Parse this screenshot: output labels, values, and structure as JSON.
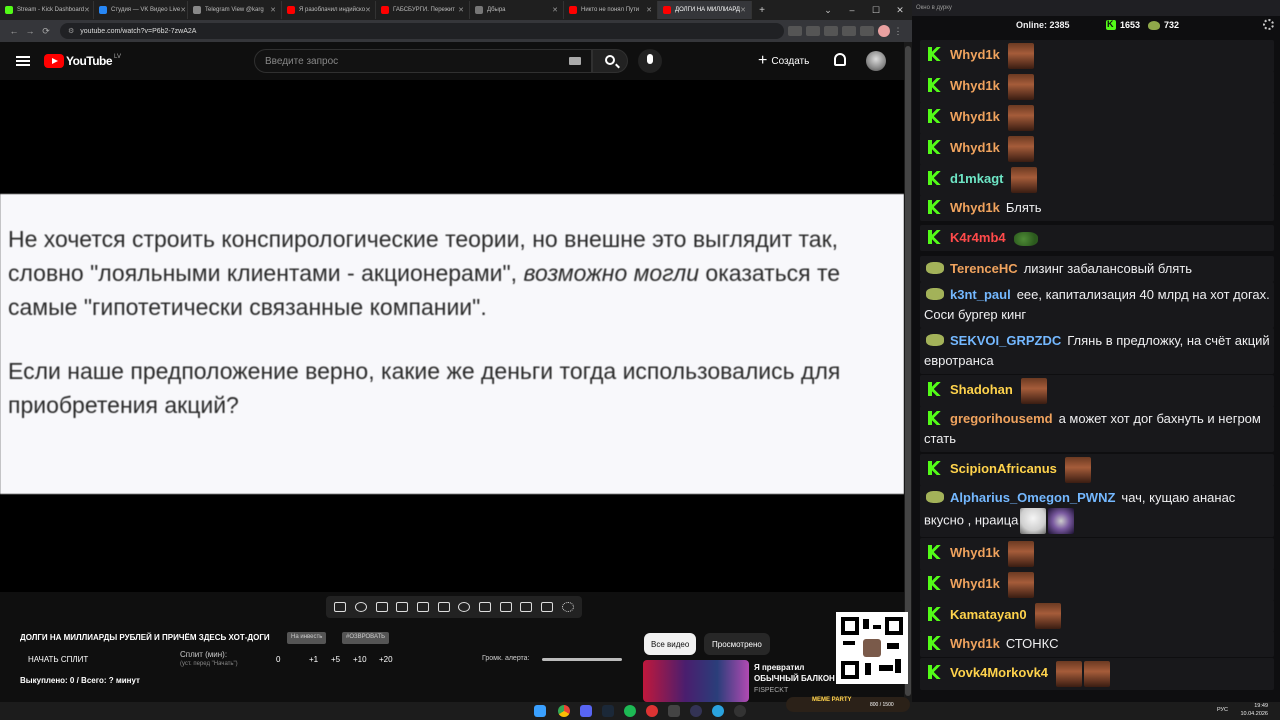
{
  "browser": {
    "tabs": [
      {
        "label": "Stream - Kick Dashboard",
        "color": "#53fc18",
        "active": false
      },
      {
        "label": "Студия — VK Видео Live",
        "color": "#2787f5",
        "active": false
      },
      {
        "label": "Telegram View @karg",
        "color": "#888888",
        "active": false
      },
      {
        "label": "Я разоблачил индийско",
        "color": "#ff0000",
        "active": false
      },
      {
        "label": "ГАБСБУРГИ. Пережит",
        "color": "#ff0000",
        "active": false
      },
      {
        "label": "Дбыра",
        "color": "#777777",
        "active": false
      },
      {
        "label": "Никто не понял Пути",
        "color": "#ff0000",
        "active": false
      },
      {
        "label": "ДОЛГИ НА МИЛЛИАРД",
        "color": "#ff0000",
        "active": true
      }
    ],
    "url": "youtube.com/watch?v=P6b2-7zwA2A"
  },
  "youtube": {
    "logo_text": "YouTube",
    "region": "LV",
    "search_placeholder": "Введите запрос",
    "create_label": "Создать"
  },
  "slide": {
    "paragraph1_part1": "Не хочется строить конспирологические теории, но внешне это выглядит так, словно \"лояльными клиентами - акционерами\", ",
    "paragraph1_italic": "возможно могли",
    "paragraph1_part2": " оказаться те самые \"гипотетически связанные компании\".",
    "paragraph2": "Если наше предположение верно, какие же деньги тогда использовались для приобретения акций?"
  },
  "panel": {
    "video_title": "ДОЛГИ НА МИЛЛИАРДЫ РУБЛЕЙ И ПРИЧЁМ ЗДЕСЬ ХОТ-ДОГИ",
    "badge1": "На инвесть",
    "badge2": "#ОЗВРОВАТЬ",
    "start_split": "НАЧАТЬ СПЛИТ",
    "split_label": "Сплит (мин):",
    "split_hint": "(уст. перед \"Начать\")",
    "split_values": [
      "0",
      "+1",
      "+5",
      "+10",
      "+20"
    ],
    "alert_label": "Громк. алерта:",
    "bought": "Выкуплено: 0 / Всего: ? минут",
    "chip_all": "Все видео",
    "chip_watched": "Просмотрено",
    "rec_title": "Я превратил ОБЫЧНЫЙ БАЛКОН в ГЕЙМЕРСКИЙ",
    "rec_channel": "FISPECKT"
  },
  "chat": {
    "window_title": "Окно в дурку",
    "online_label": "Online: 2385",
    "kick_count": "1653",
    "other_count": "732",
    "messages": [
      {
        "nick": "Whyd1k",
        "color": "#f0a35e",
        "text": "",
        "badge": "kick",
        "emotes": 1
      },
      {
        "nick": "Whyd1k",
        "color": "#f0a35e",
        "text": "",
        "badge": "kick",
        "emotes": 1
      },
      {
        "nick": "Whyd1k",
        "color": "#f0a35e",
        "text": "",
        "badge": "kick",
        "emotes": 1
      },
      {
        "nick": "Whyd1k",
        "color": "#f0a35e",
        "text": "",
        "badge": "kick",
        "emotes": 1
      },
      {
        "nick": "d1mkagt",
        "color": "#6ee6c6",
        "text": "",
        "badge": "kick",
        "emotes": 1
      },
      {
        "nick": "Whyd1k",
        "color": "#f0a35e",
        "text": "Блять",
        "badge": "kick",
        "emotes": 0
      },
      {
        "nick": "K4r4mb4",
        "color": "#ff4a4a",
        "text": "",
        "badge": "kick",
        "emotes": 1
      },
      {
        "nick": "TerenceHC",
        "color": "#f0a35e",
        "text": "лизинг забалансовый блять",
        "badge": "frog",
        "emotes": 0
      },
      {
        "nick": "k3nt_paul",
        "color": "#74b8ff",
        "text": "еее, капитализация 40 млрд на хот догах. Соси бургер кинг",
        "badge": "frog",
        "emotes": 0
      },
      {
        "nick": "SEKVOI_GRPZDC",
        "color": "#74b8ff",
        "text": "Глянь в предложку, на счёт акций евротранса",
        "badge": "frog",
        "emotes": 0
      },
      {
        "nick": "Shadohan",
        "color": "#ffd34c",
        "text": "",
        "badge": "kick",
        "emotes": 1
      },
      {
        "nick": "gregorihousemd",
        "color": "#f0a35e",
        "text": "а может хот дог бахнуть и негром стать",
        "badge": "kick",
        "emotes": 0
      },
      {
        "nick": "ScipionAfricanus",
        "color": "#ffd34c",
        "text": "",
        "badge": "kick",
        "emotes": 1
      },
      {
        "nick": "Alpharius_Omegon_PWNZ",
        "color": "#74b8ff",
        "text": "чач, кущаю ананас вкусно , нраица",
        "badge": "frog",
        "emotes": 0
      },
      {
        "nick": "Whyd1k",
        "color": "#f0a35e",
        "text": "",
        "badge": "kick",
        "emotes": 1
      },
      {
        "nick": "Whyd1k",
        "color": "#f0a35e",
        "text": "",
        "badge": "kick",
        "emotes": 1
      },
      {
        "nick": "Kamatayan0",
        "color": "#ffd34c",
        "text": "",
        "badge": "kick",
        "emotes": 1
      },
      {
        "nick": "Whyd1k",
        "color": "#f0a35e",
        "text": "СТОНКС",
        "badge": "kick",
        "emotes": 0
      },
      {
        "nick": "Vovk4Morkovk4",
        "color": "#ffd34c",
        "text": "",
        "badge": "kick",
        "emotes": 2
      }
    ]
  },
  "taskbar": {
    "meme_party": "MEME PARTY",
    "meme_count": "800 / 1500",
    "lang": "РУС",
    "time": "19:49",
    "date": "10.04.2026"
  }
}
